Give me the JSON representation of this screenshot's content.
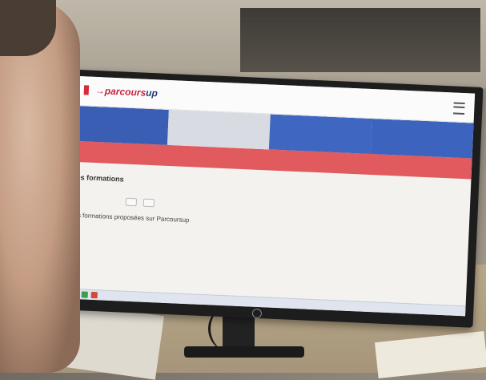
{
  "brand": {
    "name_prefix": "→",
    "name_highlight": "parcours",
    "name_rest": "up",
    "flag_colors": [
      "#2d3f8f",
      "#ffffff",
      "#d82a3a"
    ]
  },
  "menu_icon": "hamburger-icon",
  "phases": [
    {
      "date": "",
      "title": "",
      "desc": ""
    },
    {
      "date": "",
      "title": "",
      "desc": ""
    },
    {
      "date": "",
      "title": "",
      "desc": ""
    },
    {
      "date": "",
      "title": "",
      "desc": ""
    }
  ],
  "alert_text": "",
  "breadcrumb": "",
  "section": {
    "title": "Les formations",
    "description": ""
  },
  "buttons": [
    {
      "label": ""
    },
    {
      "label": ""
    }
  ],
  "subsection_title": "Les formations proposées sur Parcoursup",
  "list_lines": [
    ""
  ],
  "colors": {
    "accent_blue": "#3b5eb5",
    "alert_red": "#e15a5e",
    "brand_red": "#c6253f"
  }
}
